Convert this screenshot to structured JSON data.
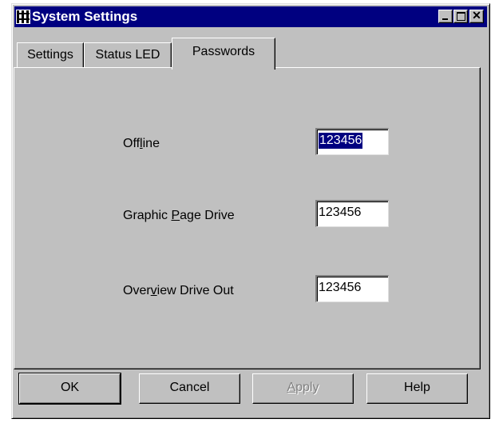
{
  "window": {
    "title": "System Settings",
    "title_bar_color": "#000080",
    "icons": {
      "app": "settings-grid-icon",
      "minimize": "minimize-icon",
      "maximize": "maximize-icon",
      "close": "close-icon"
    }
  },
  "tabs": [
    {
      "label": "Settings",
      "selected": false
    },
    {
      "label": "Status LED",
      "selected": false
    },
    {
      "label": "Passwords",
      "selected": true
    }
  ],
  "passwords": {
    "offline": {
      "label_before": "Off",
      "label_access": "l",
      "label_after": "ine",
      "value": "123456",
      "selected": true
    },
    "graphic_page_drive": {
      "label_before": "Graphic ",
      "label_access": "P",
      "label_after": "age Drive",
      "value": "123456"
    },
    "overview_drive_out": {
      "label_before": "Over",
      "label_access": "v",
      "label_after": "iew Drive Out",
      "value": "123456"
    }
  },
  "buttons": {
    "ok": "OK",
    "cancel": "Cancel",
    "apply_access": "A",
    "apply_rest": "pply",
    "apply_enabled": false,
    "help": "Help"
  }
}
